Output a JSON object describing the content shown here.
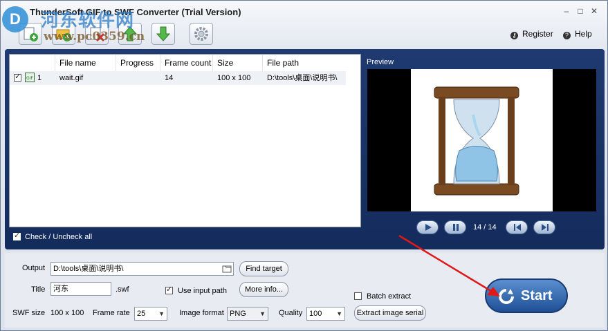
{
  "app": {
    "title": "ThunderSoft GIF to SWF Converter (Trial Version)",
    "watermark": {
      "brand_cn": "河东软件网",
      "url": "www.pc0359.cn"
    }
  },
  "window_controls": {
    "minimize": "–",
    "maximize": "□",
    "close": "✕"
  },
  "toolbar": {
    "buttons": [
      {
        "name": "add-file-icon"
      },
      {
        "name": "add-folder-icon"
      },
      {
        "name": "remove-file-icon"
      },
      {
        "name": "move-up-icon"
      },
      {
        "name": "move-down-icon"
      },
      {
        "name": "settings-gear-icon"
      }
    ]
  },
  "links": {
    "register": "Register",
    "help": "Help",
    "register_icon": "key-icon",
    "help_icon": "question-icon"
  },
  "file_list": {
    "columns": [
      "File name",
      "Progress",
      "Frame count",
      "Size",
      "File path"
    ],
    "rows": [
      {
        "checked": true,
        "index": "1",
        "file_name": "wait.gif",
        "progress": "",
        "frame_count": "14",
        "size": "100 x 100",
        "file_path": "D:\\tools\\桌面\\说明书\\"
      }
    ]
  },
  "check_all": {
    "label": "Check / Uncheck all",
    "checked": true
  },
  "preview": {
    "label": "Preview",
    "frame_counter": "14 / 14"
  },
  "output": {
    "output_label": "Output",
    "output_path": "D:\\tools\\桌面\\说明书\\",
    "find_target": "Find target",
    "title_label": "Title",
    "title_value": "河东",
    "swf_ext": ".swf",
    "use_input_path_label": "Use input path",
    "use_input_path_checked": true,
    "more_info": "More info...",
    "batch_extract_label": "Batch extract",
    "batch_extract_checked": false,
    "swf_size_label": "SWF size",
    "swf_size_value": "100 x 100",
    "frame_rate_label": "Frame rate",
    "frame_rate_value": "25",
    "image_format_label": "Image format",
    "image_format_value": "PNG",
    "quality_label": "Quality",
    "quality_value": "100",
    "extract_serial": "Extract image serial"
  },
  "start": {
    "label": "Start"
  },
  "colors": {
    "panel_dark": "#1a3466",
    "arrow_red": "#e01818"
  }
}
